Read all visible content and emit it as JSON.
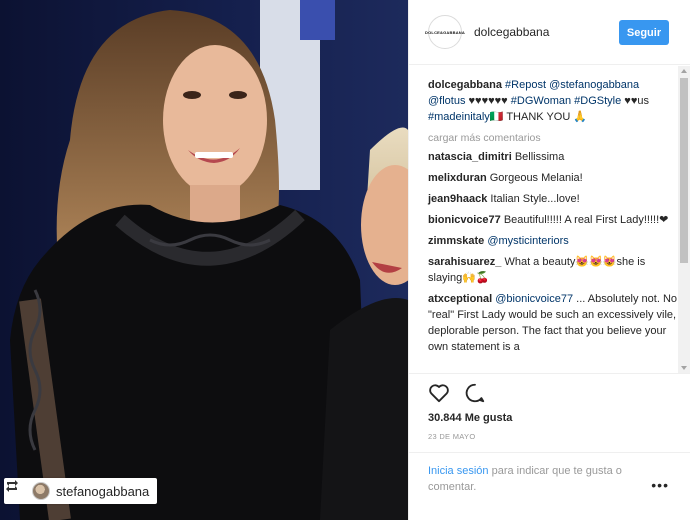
{
  "post": {
    "photo_description_icon": "image",
    "repost_tag": {
      "icon": "repost-icon",
      "username": "stefanogabbana"
    }
  },
  "header": {
    "avatar_text": "DOLCE&GABBANA",
    "username": "dolcegabbana",
    "follow_label": "Seguir"
  },
  "caption": {
    "username": "dolcegabbana",
    "segments": [
      {
        "type": "tag",
        "text": "#Repost"
      },
      {
        "type": "text",
        "text": " "
      },
      {
        "type": "tag",
        "text": "@stefanogabbana"
      },
      {
        "type": "text",
        "text": " "
      },
      {
        "type": "tag",
        "text": "@flotus"
      },
      {
        "type": "text",
        "text": " ♥♥♥♥♥♥ "
      },
      {
        "type": "tag",
        "text": "#DGWoman"
      },
      {
        "type": "text",
        "text": " "
      },
      {
        "type": "tag",
        "text": "#DGStyle"
      },
      {
        "type": "text",
        "text": " ♥♥us "
      },
      {
        "type": "tag",
        "text": "#madeinitaly"
      },
      {
        "type": "text",
        "text": "🇮🇹 THANK YOU 🙏"
      }
    ]
  },
  "load_more_label": "cargar más comentarios",
  "comments": [
    {
      "user": "natascia_dimitri",
      "segments": [
        {
          "type": "text",
          "text": "Bellissima"
        }
      ]
    },
    {
      "user": "melixduran",
      "segments": [
        {
          "type": "text",
          "text": "Gorgeous Melania!"
        }
      ]
    },
    {
      "user": "jean9haack",
      "segments": [
        {
          "type": "text",
          "text": "Italian Style...love!"
        }
      ]
    },
    {
      "user": "bionicvoice77",
      "segments": [
        {
          "type": "text",
          "text": "Beautiful!!!!! A real First Lady!!!!!❤"
        }
      ]
    },
    {
      "user": "zimmskate",
      "segments": [
        {
          "type": "tag",
          "text": "@mysticinteriors"
        }
      ]
    },
    {
      "user": "sarahisuarez_",
      "segments": [
        {
          "type": "text",
          "text": "What a beauty😻😻😻she is slaying🙌🍒"
        }
      ]
    },
    {
      "user": "atxceptional",
      "segments": [
        {
          "type": "tag",
          "text": "@bionicvoice77"
        },
        {
          "type": "text",
          "text": " ... Absolutely not. No \"real\" First Lady would be such an excessively vile, deplorable person. The fact that you believe your own statement is a"
        }
      ]
    }
  ],
  "actions": {
    "like_icon": "heart-outline-icon",
    "comment_icon": "comment-bubble-icon",
    "likes_text": "30.844 Me gusta",
    "date_text": "23 DE MAYO"
  },
  "login_prompt": {
    "link_text": "Inicia sesión",
    "rest_text": " para indicar que te gusta o comentar.",
    "more_icon": "more-options-icon",
    "more_text": "•••"
  },
  "colors": {
    "accent": "#3897f0",
    "tag": "#003569",
    "muted": "#999999",
    "text": "#262626"
  }
}
